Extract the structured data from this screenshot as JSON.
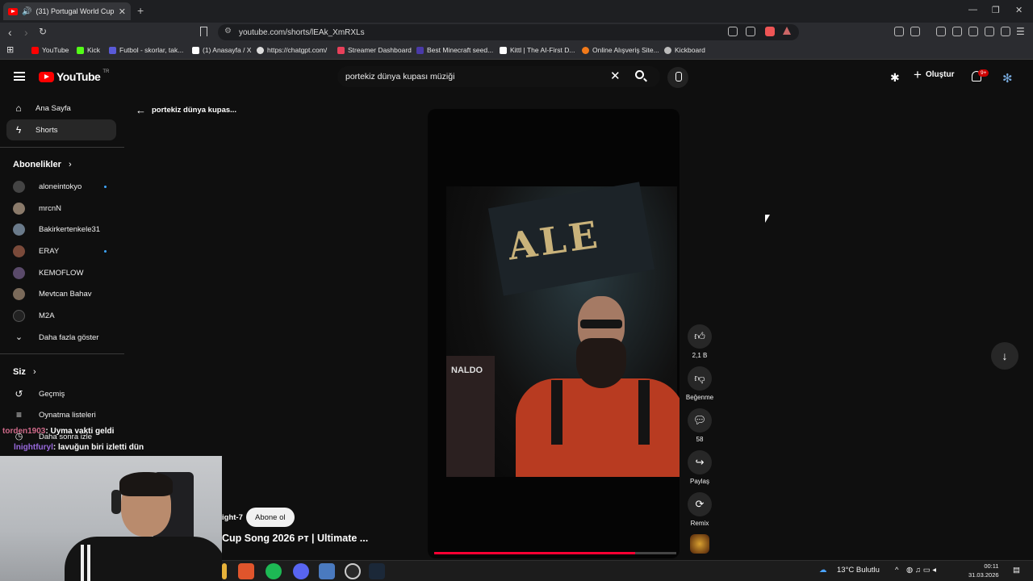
{
  "browser": {
    "tab_title": "(31) Portugal World Cup Song...",
    "url": "youtube.com/shorts/lEAk_XmRXLs",
    "bookmarks": [
      {
        "label": "YouTube",
        "color": "#ff0000"
      },
      {
        "label": "Kick",
        "color": "#53fc18"
      },
      {
        "label": "Futbol - skorlar, tak...",
        "color": "#5a5ad8"
      },
      {
        "label": "(1) Anasayfa / X",
        "color": "#ffffff"
      },
      {
        "label": "https://chatgpt.com/",
        "color": "#dddddd"
      },
      {
        "label": "Streamer Dashboard",
        "color": "#e8405a"
      },
      {
        "label": "Best Minecraft seed...",
        "color": "#4a3aa8"
      },
      {
        "label": "Kittl | The AI-First D...",
        "color": "#ffffff"
      },
      {
        "label": "Online Alışveriş Site...",
        "color": "#f27a1a"
      },
      {
        "label": "Kickboard",
        "color": "#bbbbbb"
      }
    ]
  },
  "header": {
    "logo_text": "YouTube",
    "logo_region": "TR",
    "search_query": "portekiz dünya kupası müziği",
    "create_label": "Oluştur",
    "notification_count": "9+"
  },
  "sidebar": {
    "home": "Ana Sayfa",
    "shorts": "Shorts",
    "subscriptions_heading": "Abonelikler",
    "subscriptions": [
      {
        "name": "aloneintokyo",
        "color": "#444444",
        "live": true
      },
      {
        "name": "mrcnN",
        "color": "#8a7a6a",
        "live": false
      },
      {
        "name": "Bakirkertenkele31",
        "color": "#6a7a8a",
        "live": false
      },
      {
        "name": "ERAY",
        "color": "#7a4a3a",
        "live": true
      },
      {
        "name": "KEMOFLOW",
        "color": "#5a4a6a",
        "live": false
      },
      {
        "name": "Mevtcan Bahav",
        "color": "#7a6a5a",
        "live": false
      },
      {
        "name": "M2A",
        "color": "#222222",
        "live": false
      }
    ],
    "show_more": "Daha fazla göster",
    "you_heading": "Siz",
    "history": "Geçmiş",
    "playlists": "Oynatma listeleri",
    "watch_later": "Daha sonra izle"
  },
  "main": {
    "back_label": "portekiz dünya kupas...",
    "banner_text": "ALE",
    "crowd_text": "NALDO",
    "progress": 0.83,
    "actions": {
      "like_count": "2,1 B",
      "dislike_label": "Beğenme",
      "comment_count": "58",
      "share_label": "Paylaş",
      "remix_label": "Remix"
    },
    "channel_partial": "ight-7",
    "subscribe_label": "Abone ol",
    "video_title_partial": "Cup Song 2026 ᴘᴛ | Ultimate ..."
  },
  "stream_chat": [
    {
      "user": "torden1903",
      "message": ": Uyma vakti geldi"
    },
    {
      "user": "lnightfuryl",
      "message": ": lavuğun biri izletti dün"
    }
  ],
  "taskbar": {
    "weather": "13°C  Bulutlu",
    "time": "00:11",
    "date": "31.03.2026"
  }
}
